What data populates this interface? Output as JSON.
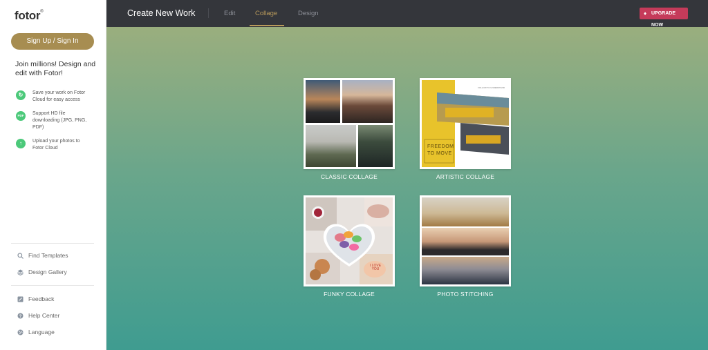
{
  "sidebar": {
    "logo": "fotor",
    "logo_mark": "®",
    "signup_label": "Sign Up / Sign In",
    "tagline": "Join millions! Design and edit with Fotor!",
    "features": [
      {
        "icon": "refresh-icon",
        "text": "Save your work on Fotor Cloud for easy access"
      },
      {
        "icon": "pdf-icon",
        "icon_text": "PDF",
        "text": "Support HD file downloading (JPG, PNG, PDF)"
      },
      {
        "icon": "upload-icon",
        "text": "Upload your photos to Fotor Cloud"
      }
    ],
    "nav_primary": [
      {
        "icon": "search-icon",
        "label": "Find Templates"
      },
      {
        "icon": "layers-icon",
        "label": "Design Gallery"
      }
    ],
    "nav_secondary": [
      {
        "icon": "feedback-icon",
        "label": "Feedback"
      },
      {
        "icon": "help-icon",
        "label": "Help Center"
      },
      {
        "icon": "globe-icon",
        "label": "Language"
      }
    ]
  },
  "topbar": {
    "title": "Create New Work",
    "tabs": [
      {
        "label": "Edit",
        "active": false
      },
      {
        "label": "Collage",
        "active": true
      },
      {
        "label": "Design",
        "active": false
      }
    ],
    "upgrade_label": "UPGRADE NOW",
    "accent_color": "#b99a5b",
    "upgrade_color": "#c53b5a"
  },
  "collage_options": [
    {
      "label": "CLASSIC COLLAGE"
    },
    {
      "label": "ARTISTIC COLLAGE",
      "poster_caption": "FOLLOW TO UNDERSTAND",
      "poster_text": "FREEDOM TO MOVE"
    },
    {
      "label": "FUNKY COLLAGE",
      "heart_text": "I LOVE YOU"
    },
    {
      "label": "PHOTO STITCHING"
    }
  ]
}
